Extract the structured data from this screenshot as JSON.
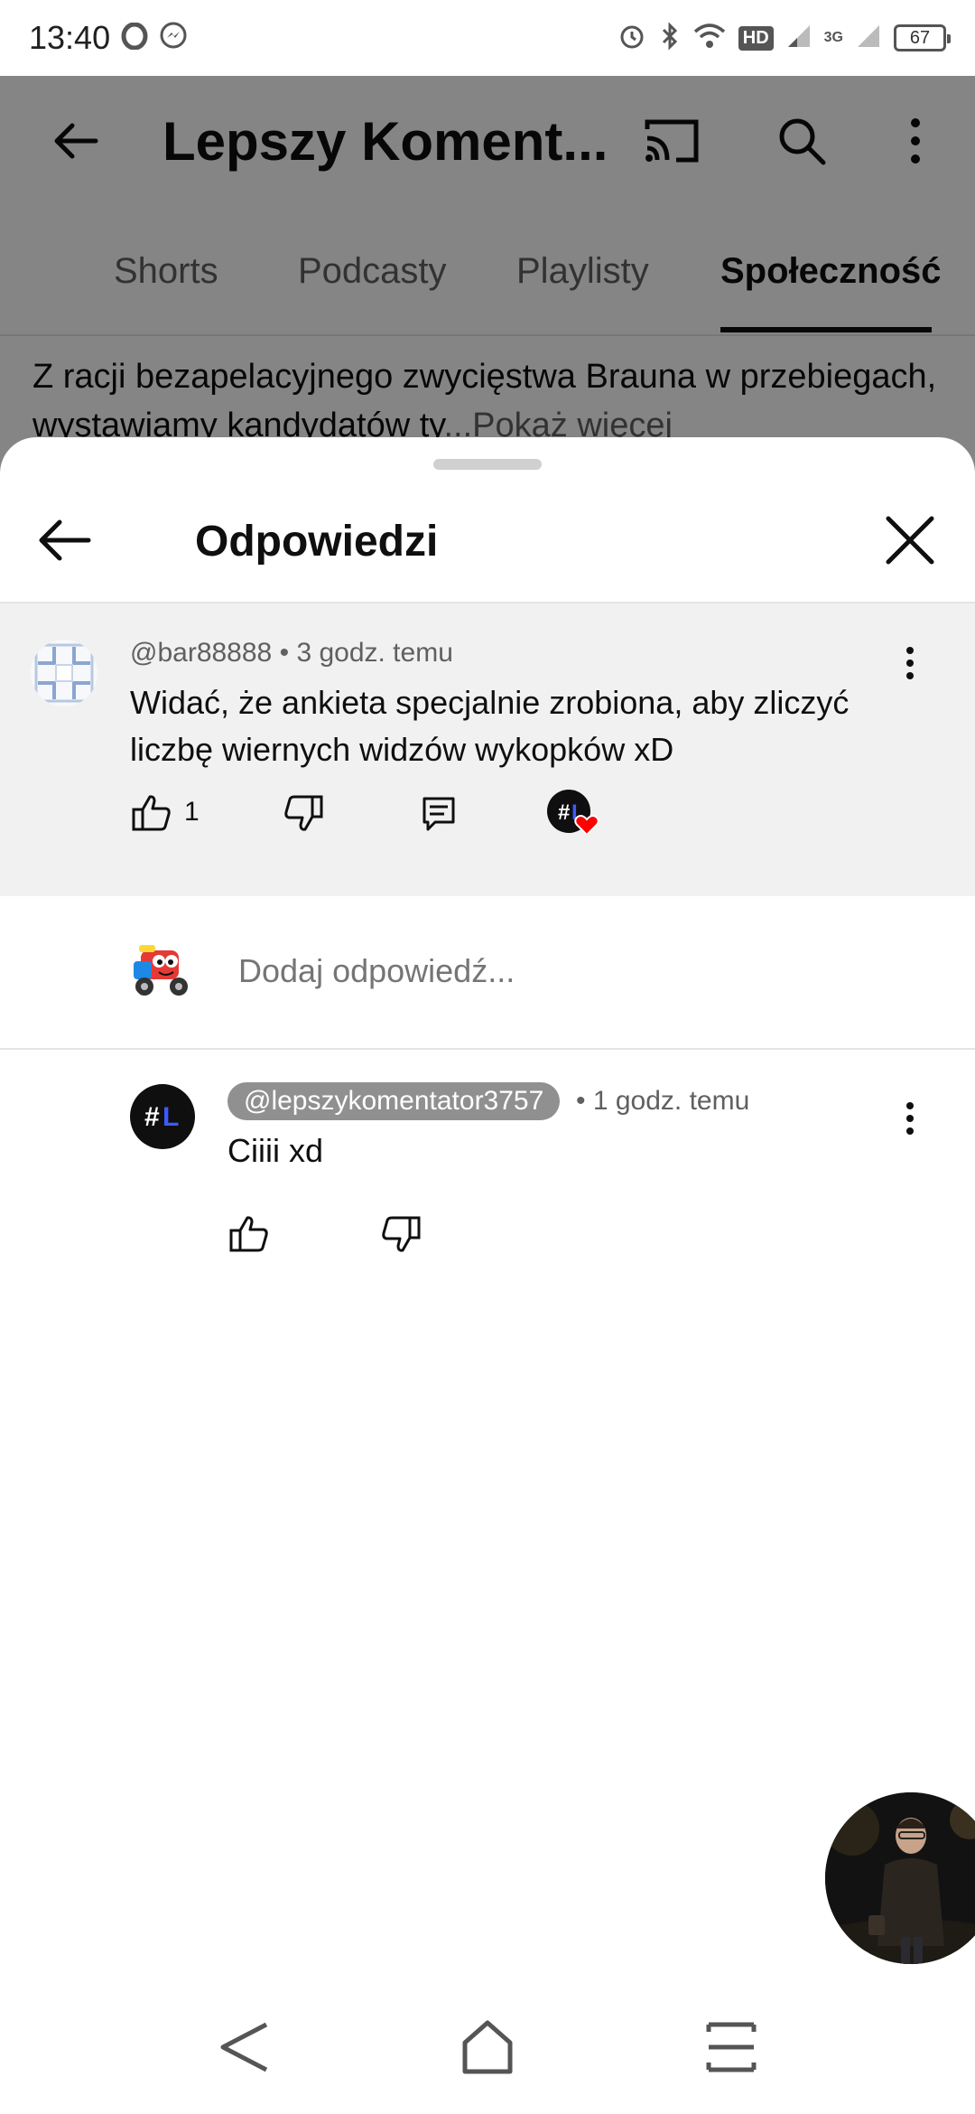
{
  "status_bar": {
    "time": "13:40",
    "hd": "HD",
    "network": "3G",
    "battery": "67"
  },
  "background": {
    "title": "Lepszy Koment...",
    "tabs": [
      {
        "label": "Shorts"
      },
      {
        "label": "Podcasty"
      },
      {
        "label": "Playlisty"
      },
      {
        "label": "Społeczność"
      }
    ],
    "active_tab": "Społeczność",
    "post_text": "Z racji bezapelacyjnego zwycięstwa Brauna w przebiegach, wystawiamy kandydatów ty",
    "show_more": "...Pokaż więcej"
  },
  "sheet": {
    "title": "Odpowiedzi"
  },
  "parent_comment": {
    "author": "@bar88888",
    "time": "3 godz. temu",
    "text": "Widać, że ankieta specjalnie zrobiona, aby zliczyć liczbę wiernych widzów wykopków xD",
    "likes": "1"
  },
  "reply_input": {
    "placeholder": "Dodaj odpowiedź..."
  },
  "reply": {
    "author": "@lepszykomentator3757",
    "time": "1 godz. temu",
    "text": "Ciiii xd"
  },
  "colors": {
    "scrim": "#000000",
    "chip": "#909090",
    "heart": "#ff0000",
    "creator_l": "#3d5afe"
  }
}
